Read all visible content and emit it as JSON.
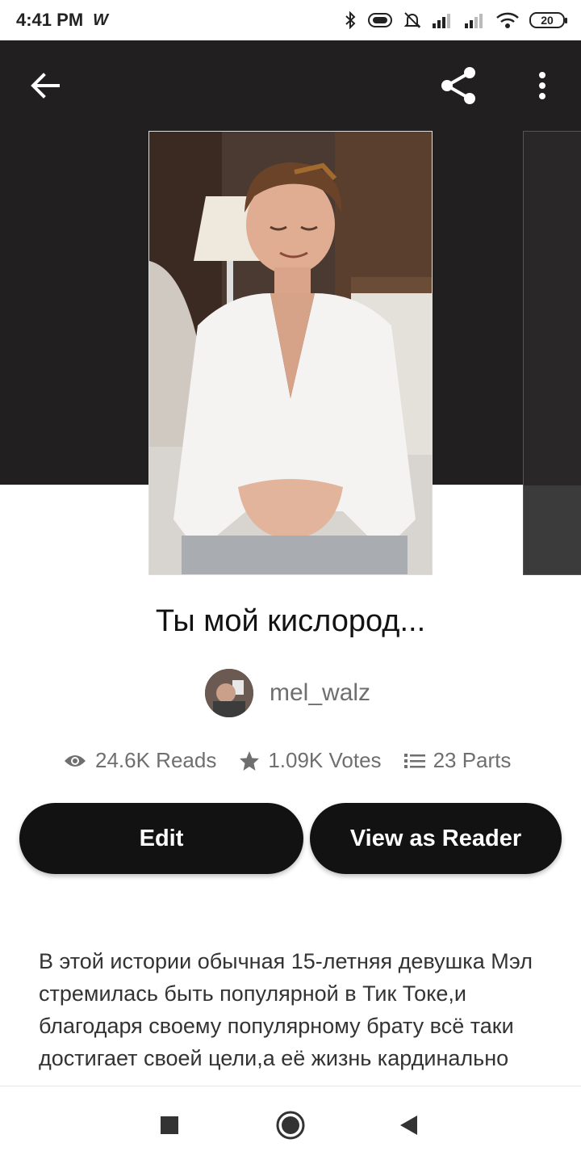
{
  "status_bar": {
    "time": "4:41 PM",
    "app_glyph": "W",
    "battery": "20",
    "icons": [
      "bluetooth-icon",
      "vibrate-icon",
      "mute-icon",
      "signal-icon",
      "signal-icon",
      "wifi-icon",
      "battery-icon"
    ]
  },
  "toolbar": {
    "back_icon": "arrow-left-icon",
    "share_icon": "share-icon",
    "more_icon": "more-vertical-icon"
  },
  "story": {
    "title": "Ты мой кислород...",
    "author": "mel_walz",
    "stats": {
      "reads": "24.6K Reads",
      "votes": "1.09K Votes",
      "parts": "23 Parts"
    },
    "description": "В этой истории обычная 15-летняя девушка Мэл стремилась быть популярной в Тик Токе,и благодаря своему популярному брату всё таки достигает своей цели,а её жизнь кардинально"
  },
  "actions": {
    "edit_label": "Edit",
    "reader_label": "View as Reader"
  },
  "colors": {
    "header_bg": "#221f20",
    "button_bg": "#121212",
    "muted_text": "#6f6f6f"
  },
  "nav_bar": {
    "icons": [
      "recents-square-icon",
      "home-circle-icon",
      "back-triangle-icon"
    ]
  }
}
